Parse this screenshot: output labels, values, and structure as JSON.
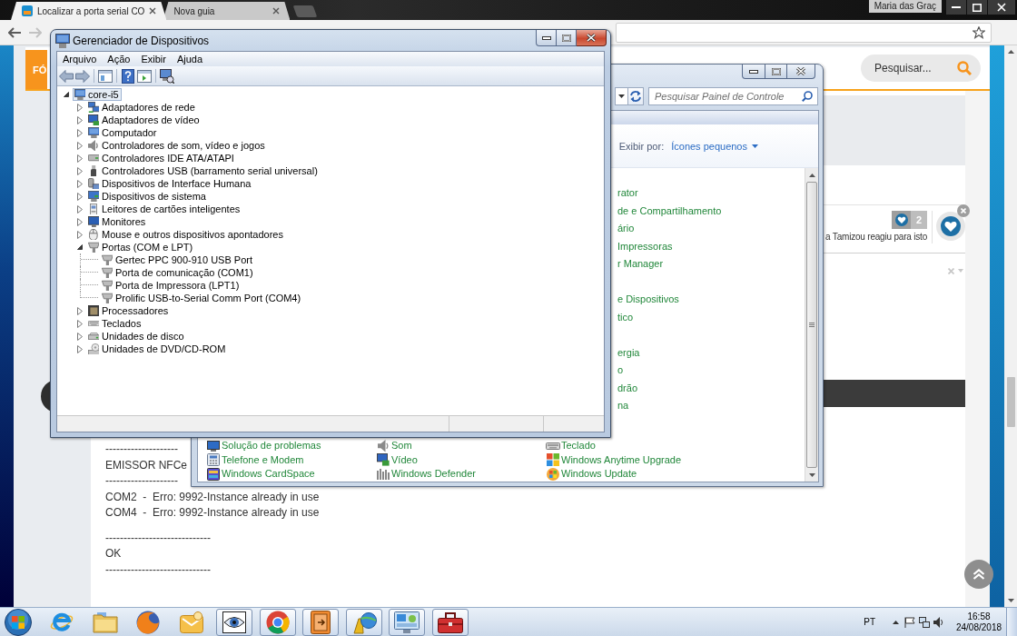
{
  "browser": {
    "tabs": [
      {
        "title": "Localizar a porta serial CO",
        "has_icon": true,
        "selected": true
      },
      {
        "title": "Nova guia",
        "has_icon": false,
        "selected": false
      }
    ],
    "profile": "Maria das Graç",
    "navigation": [
      {
        "kind": "back",
        "disabled": false
      },
      {
        "kind": "forward",
        "disabled": true
      }
    ]
  },
  "device_manager": {
    "title": "Gerenciador de Dispositivos",
    "menu": [
      "Arquivo",
      "Ação",
      "Exibir",
      "Ajuda"
    ],
    "toolbar": [
      {
        "kind": "back"
      },
      {
        "kind": "forward"
      },
      {
        "kind": "separator"
      },
      {
        "kind": "console"
      },
      {
        "kind": "separator"
      },
      {
        "kind": "help"
      },
      {
        "kind": "properties"
      },
      {
        "kind": "separator"
      },
      {
        "kind": "scan"
      }
    ],
    "tree": [
      {
        "label": "core-i5",
        "kind": "computer",
        "expanded": true,
        "selected": true,
        "children": [
          {
            "label": "Adaptadores de rede",
            "kind": "network",
            "expanded": false,
            "selected": false
          },
          {
            "label": "Adaptadores de vídeo",
            "kind": "display",
            "expanded": false,
            "selected": false
          },
          {
            "label": "Computador",
            "kind": "computer",
            "expanded": false,
            "selected": false
          },
          {
            "label": "Controladores de som, vídeo e jogos",
            "kind": "sound",
            "expanded": false,
            "selected": false
          },
          {
            "label": "Controladores IDE ATA/ATAPI",
            "kind": "ide",
            "expanded": false,
            "selected": false
          },
          {
            "label": "Controladores USB (barramento serial universal)",
            "kind": "usb",
            "expanded": false,
            "selected": false
          },
          {
            "label": "Dispositivos de Interface Humana",
            "kind": "hid",
            "expanded": false,
            "selected": false
          },
          {
            "label": "Dispositivos de sistema",
            "kind": "system",
            "expanded": false,
            "selected": false
          },
          {
            "label": "Leitores de cartões inteligentes",
            "kind": "smartcard",
            "expanded": false,
            "selected": false
          },
          {
            "label": "Monitores",
            "kind": "monitor",
            "expanded": false,
            "selected": false
          },
          {
            "label": "Mouse e outros dispositivos apontadores",
            "kind": "mouse",
            "expanded": false,
            "selected": false
          },
          {
            "label": "Portas (COM e LPT)",
            "kind": "port",
            "expanded": true,
            "selected": false,
            "children": [
              {
                "label": "Gertec PPC 900-910 USB Port",
                "kind": "port",
                "selected": false
              },
              {
                "label": "Porta de comunicação (COM1)",
                "kind": "port",
                "selected": false
              },
              {
                "label": "Porta de Impressora (LPT1)",
                "kind": "port",
                "selected": false
              },
              {
                "label": "Prolific USB-to-Serial Comm Port (COM4)",
                "kind": "port",
                "selected": false
              }
            ]
          },
          {
            "label": "Processadores",
            "kind": "processor",
            "expanded": false,
            "selected": false
          },
          {
            "label": "Teclados",
            "kind": "keyboard",
            "expanded": false,
            "selected": false
          },
          {
            "label": "Unidades de disco",
            "kind": "disk",
            "expanded": false,
            "selected": false
          },
          {
            "label": "Unidades de DVD/CD-ROM",
            "kind": "dvd",
            "expanded": false,
            "selected": false
          }
        ]
      }
    ]
  },
  "control_panel": {
    "search": {
      "placeholder": "Pesquisar Painel de Controle"
    },
    "view_by": {
      "label": "Exibir por:",
      "value": "Ícones pequenos"
    },
    "cut_item_groups": [
      [
        "rator",
        "de e Compartilhamento",
        "ário",
        "Impressoras",
        "r Manager"
      ],
      [
        "e Dispositivos",
        "tico"
      ],
      [
        "ergia",
        "o",
        "drão",
        "na"
      ]
    ],
    "item_rows": [
      [
        {
          "label": "Solução de problemas",
          "kind": "troubleshoot"
        },
        {
          "label": "Som",
          "kind": "sound"
        },
        {
          "label": "Teclado",
          "kind": "keyboard"
        }
      ],
      [
        {
          "label": "Telefone e Modem",
          "kind": "phone"
        },
        {
          "label": "Vídeo",
          "kind": "display"
        },
        {
          "label": "Windows Anytime Upgrade",
          "kind": "upgrade"
        }
      ],
      [
        {
          "label": "Windows CardSpace",
          "kind": "cardspace"
        },
        {
          "label": "Windows Defender",
          "kind": "defender"
        },
        {
          "label": "Windows Update",
          "kind": "update"
        }
      ]
    ]
  },
  "web_page": {
    "nav_tab": "FÓ",
    "search": {
      "placeholder": "Pesquisar..."
    },
    "reaction": {
      "count": "2",
      "text": "a Tamizou reagiu para isto"
    },
    "post_blocks": [
      [
        "--------------------",
        "EMISSOR NFCe",
        "--------------------",
        "COM2  -  Erro: 9992-Instance already in use",
        "COM4  -  Erro: 9992-Instance already in use"
      ],
      [
        "-----------------------------",
        "OK",
        "-----------------------------"
      ]
    ]
  },
  "taskbar": {
    "apps": [
      {
        "kind": "e-logo",
        "running": false
      },
      {
        "kind": "folder",
        "running": false
      },
      {
        "kind": "fox-globe",
        "running": false
      },
      {
        "kind": "envelope",
        "running": false
      },
      {
        "kind": "eye",
        "running": true
      },
      {
        "kind": "ring",
        "running": true
      },
      {
        "kind": "door",
        "running": true
      },
      {
        "kind": "globe-stand",
        "running": true
      },
      {
        "kind": "panel",
        "running": true
      },
      {
        "kind": "toolbox",
        "running": true
      }
    ],
    "language": "PT",
    "time": "16:58",
    "date": "24/08/2018"
  }
}
